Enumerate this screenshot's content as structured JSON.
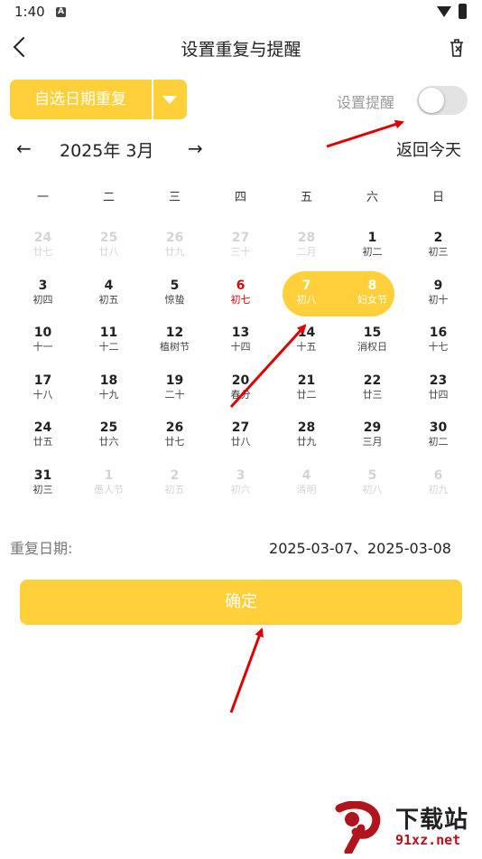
{
  "status_bar": {
    "time": "1:40",
    "notification_icon": "A"
  },
  "header": {
    "title": "设置重复与提醒"
  },
  "repeat_mode": {
    "label": "自选日期重复"
  },
  "reminder": {
    "label": "设置提醒",
    "enabled": false
  },
  "month_nav": {
    "current": "2025年  3月",
    "back_today": "返回今天"
  },
  "weekdays": [
    "一",
    "二",
    "三",
    "四",
    "五",
    "六",
    "日"
  ],
  "days": [
    {
      "num": "24",
      "lunar": "廿七",
      "state": "other"
    },
    {
      "num": "25",
      "lunar": "廿八",
      "state": "other"
    },
    {
      "num": "26",
      "lunar": "廿九",
      "state": "other"
    },
    {
      "num": "27",
      "lunar": "三十",
      "state": "other"
    },
    {
      "num": "28",
      "lunar": "二月",
      "state": "other"
    },
    {
      "num": "1",
      "lunar": "初二",
      "state": "normal"
    },
    {
      "num": "2",
      "lunar": "初三",
      "state": "normal"
    },
    {
      "num": "3",
      "lunar": "初四",
      "state": "normal"
    },
    {
      "num": "4",
      "lunar": "初五",
      "state": "normal"
    },
    {
      "num": "5",
      "lunar": "惊蛰",
      "state": "normal"
    },
    {
      "num": "6",
      "lunar": "初七",
      "state": "holiday"
    },
    {
      "num": "7",
      "lunar": "初八",
      "state": "selected"
    },
    {
      "num": "8",
      "lunar": "妇女节",
      "state": "selected"
    },
    {
      "num": "9",
      "lunar": "初十",
      "state": "normal"
    },
    {
      "num": "10",
      "lunar": "十一",
      "state": "normal"
    },
    {
      "num": "11",
      "lunar": "十二",
      "state": "normal"
    },
    {
      "num": "12",
      "lunar": "植树节",
      "state": "normal"
    },
    {
      "num": "13",
      "lunar": "十四",
      "state": "normal"
    },
    {
      "num": "14",
      "lunar": "十五",
      "state": "normal"
    },
    {
      "num": "15",
      "lunar": "消权日",
      "state": "normal"
    },
    {
      "num": "16",
      "lunar": "十七",
      "state": "normal"
    },
    {
      "num": "17",
      "lunar": "十八",
      "state": "normal"
    },
    {
      "num": "18",
      "lunar": "十九",
      "state": "normal"
    },
    {
      "num": "19",
      "lunar": "二十",
      "state": "normal"
    },
    {
      "num": "20",
      "lunar": "春分",
      "state": "normal"
    },
    {
      "num": "21",
      "lunar": "廿二",
      "state": "normal"
    },
    {
      "num": "22",
      "lunar": "廿三",
      "state": "normal"
    },
    {
      "num": "23",
      "lunar": "廿四",
      "state": "normal"
    },
    {
      "num": "24",
      "lunar": "廿五",
      "state": "normal"
    },
    {
      "num": "25",
      "lunar": "廿六",
      "state": "normal"
    },
    {
      "num": "26",
      "lunar": "廿七",
      "state": "normal"
    },
    {
      "num": "27",
      "lunar": "廿八",
      "state": "normal"
    },
    {
      "num": "28",
      "lunar": "廿九",
      "state": "normal"
    },
    {
      "num": "29",
      "lunar": "三月",
      "state": "normal"
    },
    {
      "num": "30",
      "lunar": "初二",
      "state": "normal"
    },
    {
      "num": "31",
      "lunar": "初三",
      "state": "normal"
    },
    {
      "num": "1",
      "lunar": "愚人节",
      "state": "other"
    },
    {
      "num": "2",
      "lunar": "初五",
      "state": "other"
    },
    {
      "num": "3",
      "lunar": "初六",
      "state": "other"
    },
    {
      "num": "4",
      "lunar": "清明",
      "state": "other"
    },
    {
      "num": "5",
      "lunar": "初八",
      "state": "other"
    },
    {
      "num": "6",
      "lunar": "初九",
      "state": "other"
    }
  ],
  "repeat_dates": {
    "label": "重复日期:",
    "value": "2025-03-07、2025-03-08"
  },
  "confirm": {
    "label": "确定"
  },
  "watermark": {
    "title": "下载站",
    "url": "91xz.net"
  },
  "colors": {
    "accent": "#FFD03A",
    "holiday": "#e00000",
    "annotation_arrow": "#e00000"
  },
  "icons": {
    "back": "back-arrow-icon",
    "trash": "trash-icon",
    "dropdown": "caret-down-icon",
    "prev_month": "left-arrow-icon",
    "next_month": "right-arrow-icon"
  }
}
